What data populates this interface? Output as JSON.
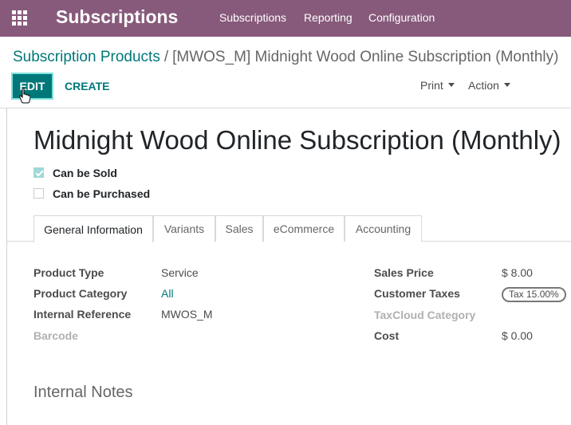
{
  "header": {
    "app_name": "Subscriptions",
    "menu": [
      "Subscriptions",
      "Reporting",
      "Configuration"
    ]
  },
  "control_panel": {
    "breadcrumb_parent": "Subscription Products",
    "breadcrumb_separator": "/",
    "breadcrumb_current": "[MWOS_M] Midnight Wood Online Subscription (Monthly)",
    "edit_label": "EDIT",
    "create_label": "CREATE",
    "print_label": "Print",
    "action_label": "Action"
  },
  "product": {
    "name": "Midnight Wood Online Subscription (Monthly)",
    "can_be_sold_label": "Can be Sold",
    "can_be_sold": true,
    "can_be_purchased_label": "Can be Purchased",
    "can_be_purchased": false
  },
  "tabs": [
    "General Information",
    "Variants",
    "Sales",
    "eCommerce",
    "Accounting"
  ],
  "active_tab": "General Information",
  "general": {
    "product_type_label": "Product Type",
    "product_type": "Service",
    "product_category_label": "Product Category",
    "product_category": "All",
    "internal_reference_label": "Internal Reference",
    "internal_reference": "MWOS_M",
    "barcode_label": "Barcode",
    "sales_price_label": "Sales Price",
    "sales_price": "$ 8.00",
    "customer_taxes_label": "Customer Taxes",
    "customer_taxes": "Tax 15.00%",
    "taxcloud_category_label": "TaxCloud Category",
    "cost_label": "Cost",
    "cost": "$ 0.00"
  },
  "notes": {
    "title": "Internal Notes"
  },
  "colors": {
    "brand": "#875a7b",
    "primary": "#00787a",
    "text": "#4c4c4c"
  }
}
